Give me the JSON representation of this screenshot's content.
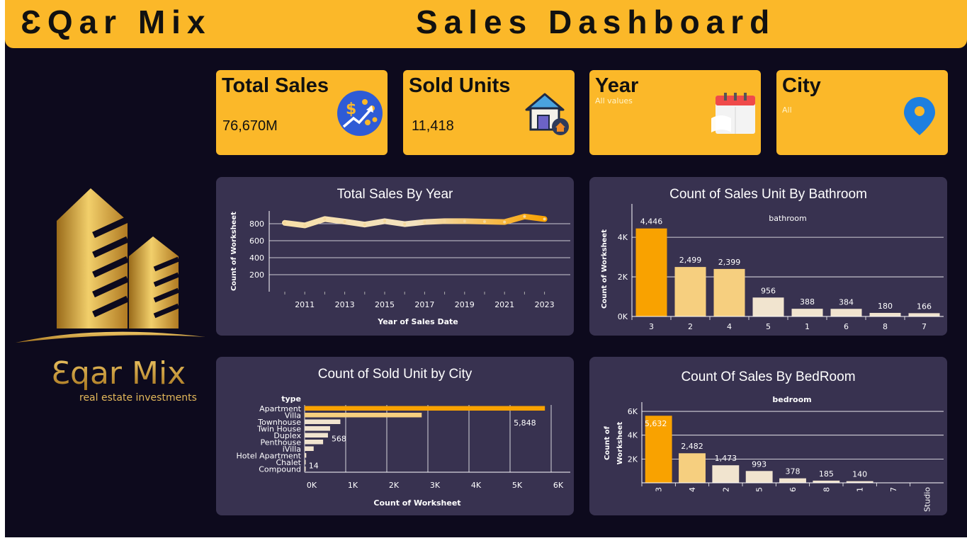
{
  "header": {
    "brand": "ƐQar Mix",
    "title": "Sales Dashboard"
  },
  "kpis": {
    "total_sales": {
      "title": "Total Sales",
      "value": "76,670M",
      "icon": "dollar-growth-icon"
    },
    "sold_units": {
      "title": "Sold Units",
      "value": "11,418",
      "icon": "house-icon"
    },
    "year": {
      "title": "Year",
      "filter": "All values",
      "icon": "calendar-icon"
    },
    "city": {
      "title": "City",
      "filter": "All",
      "icon": "location-pin-icon"
    }
  },
  "logo": {
    "wordmark": "Ɛqar Mix",
    "tagline": "real estate investments"
  },
  "colors": {
    "accent": "#fbb829",
    "panel": "#383250",
    "background": "#0d0a1d",
    "bar_top": "#f9a200"
  },
  "chart_data": [
    {
      "id": "sales_by_year",
      "type": "line",
      "title": "Total Sales By Year",
      "xlabel": "Year of Sales Date",
      "ylabel": "Count of Worksheet",
      "x": [
        2010,
        2011,
        2012,
        2013,
        2014,
        2015,
        2016,
        2017,
        2018,
        2019,
        2020,
        2021,
        2022,
        2023
      ],
      "values": [
        810,
        780,
        855,
        825,
        790,
        830,
        795,
        820,
        830,
        830,
        825,
        820,
        885,
        855
      ],
      "x_ticks": [
        "2011",
        "2013",
        "2015",
        "2017",
        "2019",
        "2021",
        "2023"
      ],
      "y_ticks": [
        "200",
        "400",
        "600",
        "800"
      ],
      "ylim": [
        0,
        950
      ],
      "grid": true
    },
    {
      "id": "units_by_bathroom",
      "type": "bar",
      "title": "Count of Sales Unit By Bathroom",
      "legend_title": "bathroom",
      "ylabel": "Count of Worksheet",
      "categories": [
        "3",
        "2",
        "4",
        "5",
        "1",
        "6",
        "8",
        "7"
      ],
      "values": [
        4446,
        2499,
        2399,
        956,
        388,
        384,
        180,
        166
      ],
      "value_labels": [
        "4,446",
        "2,499",
        "2,399",
        "956",
        "388",
        "384",
        "180",
        "166"
      ],
      "y_ticks": [
        "0K",
        "2K",
        "4K"
      ],
      "ylim": [
        0,
        5400
      ],
      "grid": true
    },
    {
      "id": "sold_unit_by_city",
      "type": "bar",
      "orientation": "horizontal",
      "title": "Count of Sold Unit by City",
      "category_header": "type",
      "xlabel": "Count of Worksheet",
      "categories": [
        "Apartment",
        "Villa",
        "Townhouse",
        "Twin House",
        "Duplex",
        "Penthouse",
        "iVilla",
        "Hotel Apartment",
        "Chalet",
        "Compound"
      ],
      "values": [
        5848,
        2850,
        870,
        620,
        568,
        450,
        220,
        40,
        14,
        10
      ],
      "value_labels": {
        "0": "5,848",
        "4": "568",
        "8": "14"
      },
      "x_ticks": [
        "0K",
        "1K",
        "2K",
        "3K",
        "4K",
        "5K",
        "6K"
      ],
      "xlim": [
        0,
        6000
      ],
      "grid": true
    },
    {
      "id": "sales_by_bedroom",
      "type": "bar",
      "title": "Count Of Sales By BedRoom",
      "legend_title": "bedroom",
      "ylabel": "Count of Worksheet",
      "categories": [
        "3",
        "4",
        "2",
        "5",
        "6",
        "8",
        "1",
        "7",
        "Studio"
      ],
      "values": [
        5632,
        2482,
        1473,
        993,
        378,
        185,
        140,
        0,
        0
      ],
      "value_labels": [
        "5,632",
        "2,482",
        "1,473",
        "993",
        "378",
        "185",
        "140",
        "",
        ""
      ],
      "y_ticks": [
        "2K",
        "4K",
        "6K"
      ],
      "ylim": [
        0,
        6300
      ],
      "grid": true
    }
  ]
}
